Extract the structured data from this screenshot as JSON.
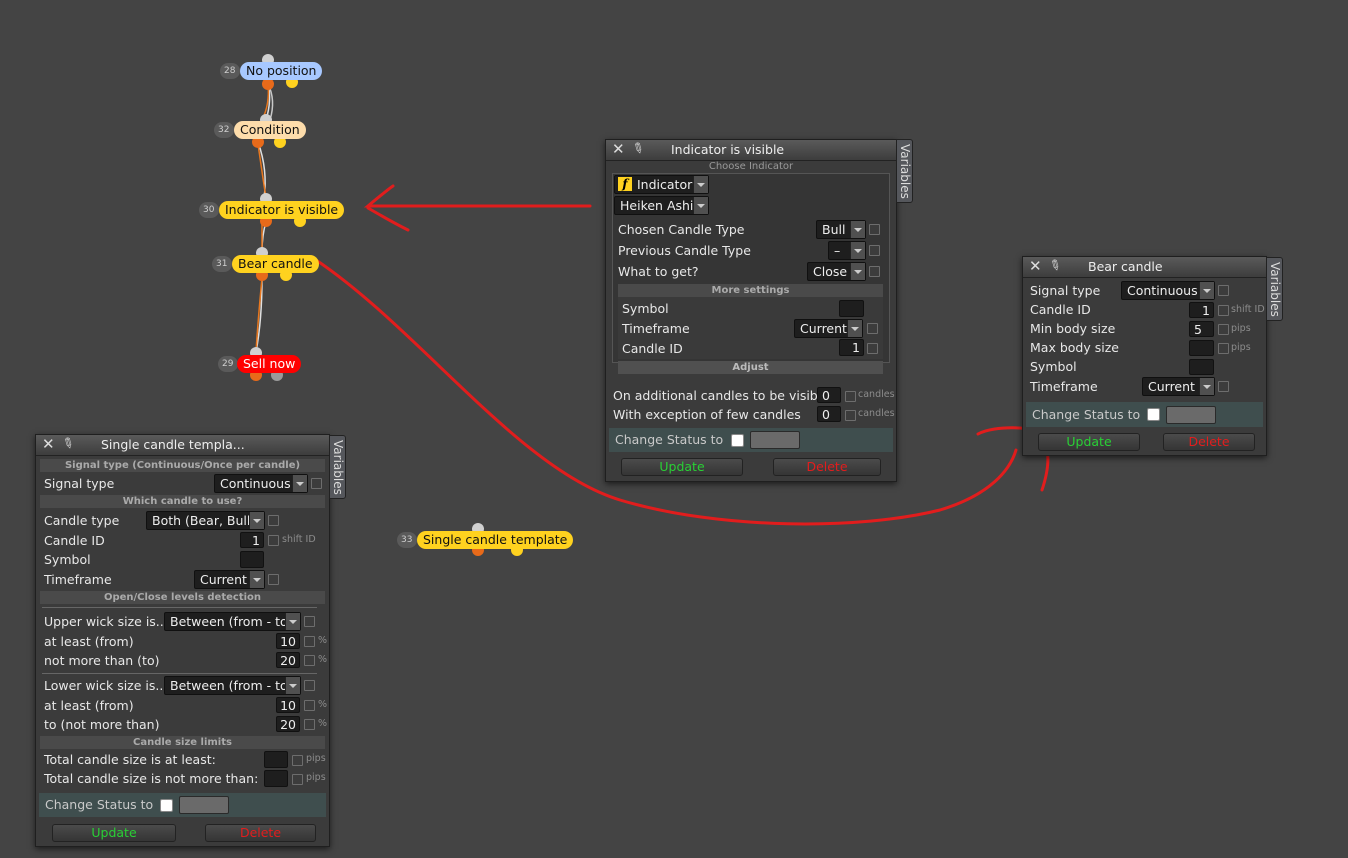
{
  "colors": {
    "accent_red": "#e11d1d",
    "pill_blue": "#a7c8ff",
    "pill_peach": "#fddcab",
    "pill_yellow": "#ffd21f",
    "pill_red": "#ff0000",
    "update_green": "#29d035"
  },
  "nodes": {
    "n28": {
      "num": "28",
      "label": "No position"
    },
    "n32": {
      "num": "32",
      "label": "Condition"
    },
    "n30": {
      "num": "30",
      "label": "Indicator is visible"
    },
    "n31": {
      "num": "31",
      "label": "Bear candle"
    },
    "n29": {
      "num": "29",
      "label": "Sell now"
    },
    "n33": {
      "num": "33",
      "label": "Single candle template"
    }
  },
  "indicator_panel": {
    "title": "Indicator is visible",
    "vtab": "Variables",
    "choose_indicator": "Choose Indicator",
    "indicator_type": "Indicator",
    "indicator_icon": "f",
    "indicator_name": "Heiken Ashi",
    "rows": {
      "chosen_candle_type": {
        "label": "Chosen Candle Type",
        "value": "Bull"
      },
      "previous_candle_type": {
        "label": "Previous Candle Type",
        "value": "–"
      },
      "what_to_get": {
        "label": "What to get?",
        "value": "Close"
      }
    },
    "more_settings": "More settings",
    "symbol_label": "Symbol",
    "timeframe_label": "Timeframe",
    "timeframe_value": "Current",
    "candle_id_label": "Candle ID",
    "candle_id_value": "1",
    "adjust": "Adjust",
    "additional_label": "On additional candles to be visible",
    "additional_value": "0",
    "additional_unit": "candles",
    "exception_label": "With exception of few candles",
    "exception_value": "0",
    "exception_unit": "candles",
    "change_status": "Change Status to",
    "update": "Update",
    "delete": "Delete"
  },
  "bear_panel": {
    "title": "Bear candle",
    "vtab": "Variables",
    "signal_type_label": "Signal type",
    "signal_type_value": "Continuous",
    "candle_id_label": "Candle ID",
    "candle_id_value": "1",
    "candle_id_unit": "shift ID",
    "min_body_label": "Min body size",
    "min_body_value": "5",
    "min_body_unit": "pips",
    "max_body_label": "Max body size",
    "max_body_unit": "pips",
    "symbol_label": "Symbol",
    "timeframe_label": "Timeframe",
    "timeframe_value": "Current",
    "change_status": "Change Status to",
    "update": "Update",
    "delete": "Delete"
  },
  "single_panel": {
    "title": "Single candle templa...",
    "vtab": "Variables",
    "sec_signal": "Signal type (Continuous/Once per candle)",
    "signal_type_label": "Signal type",
    "signal_type_value": "Continuous",
    "sec_which": "Which candle to use?",
    "candle_type_label": "Candle type",
    "candle_type_value": "Both (Bear, Bull)",
    "candle_id_label": "Candle ID",
    "candle_id_value": "1",
    "candle_id_unit": "shift ID",
    "symbol_label": "Symbol",
    "timeframe_label": "Timeframe",
    "timeframe_value": "Current",
    "sec_openclose": "Open/Close levels detection",
    "upper_wick_label": "Upper wick size is...",
    "upper_wick_value": "Between (from - to)",
    "upper_least_label": "at least (from)",
    "upper_least_value": "10",
    "upper_more_label": "not more than (to)",
    "upper_more_value": "20",
    "lower_wick_label": "Lower wick size is...",
    "lower_wick_value": "Between (from - to)",
    "lower_least_label": "at least (from)",
    "lower_least_value": "10",
    "lower_more_label": "to (not more than)",
    "lower_more_value": "20",
    "pct": "%",
    "sec_size": "Candle size limits",
    "total_least_label": "Total candle size is at least:",
    "total_more_label": "Total candle size is not more than:",
    "pips": "pips",
    "change_status": "Change Status to",
    "update": "Update",
    "delete": "Delete"
  }
}
